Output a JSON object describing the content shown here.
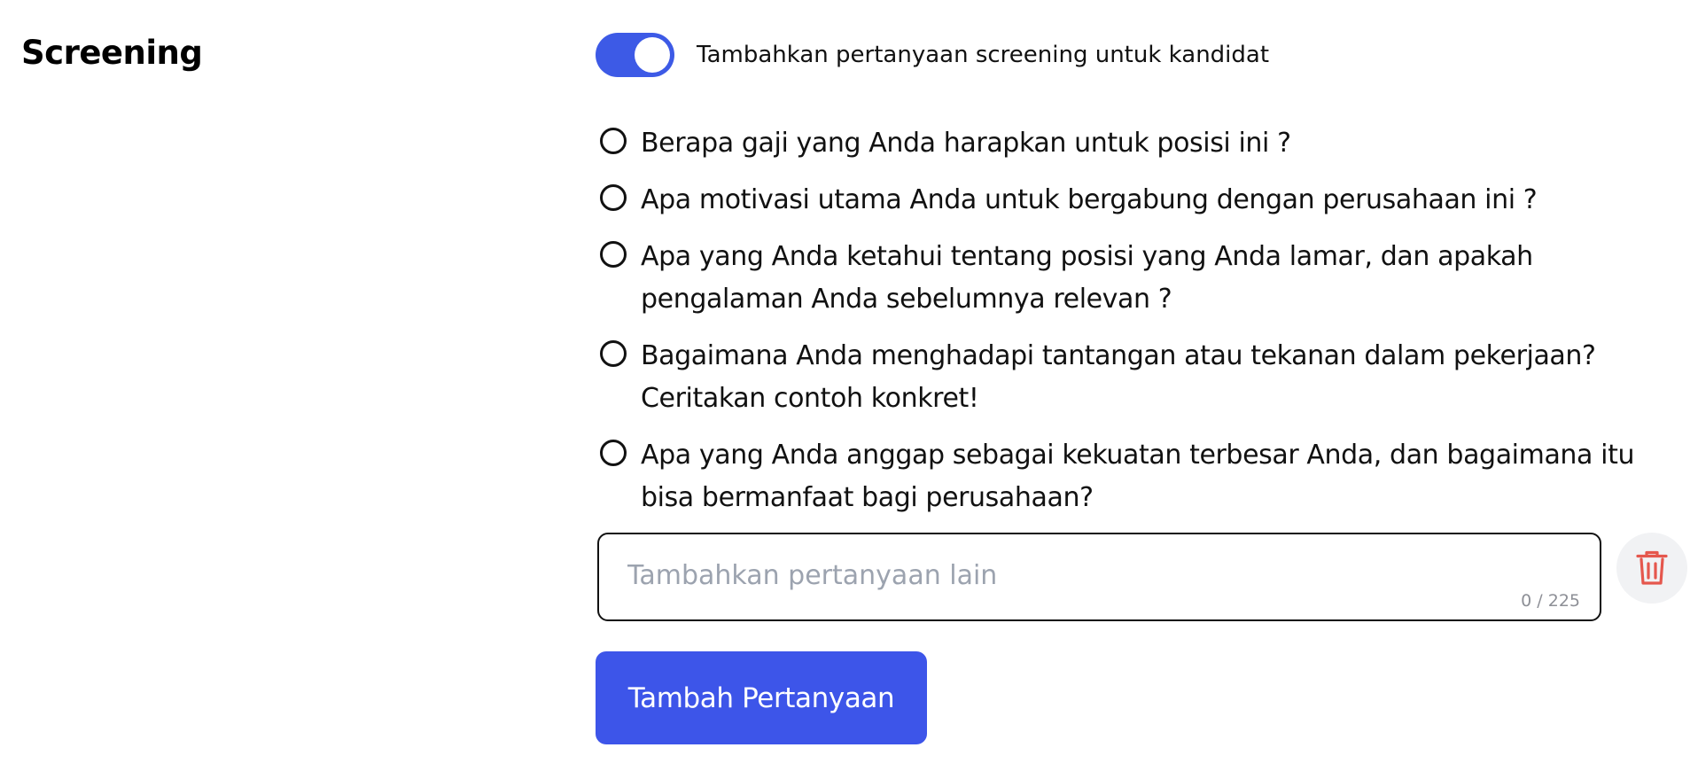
{
  "section": {
    "title": "Screening"
  },
  "toggle": {
    "label": "Tambahkan pertanyaan screening untuk kandidat",
    "state": "on",
    "color": "#3d5ae6"
  },
  "questions": [
    {
      "text": "Berapa gaji yang Anda harapkan untuk posisi ini ?"
    },
    {
      "text": "Apa motivasi utama Anda untuk bergabung dengan perusahaan ini ?"
    },
    {
      "text": "Apa yang Anda ketahui tentang posisi yang Anda lamar, dan apakah pengalaman Anda sebelumnya relevan ?"
    },
    {
      "text": "Bagaimana Anda menghadapi tantangan atau tekanan dalam pekerjaan? Ceritakan contoh konkret!"
    },
    {
      "text": "Apa yang Anda anggap sebagai kekuatan terbesar Anda, dan bagaimana itu bisa bermanfaat bagi perusahaan?"
    }
  ],
  "other_question": {
    "placeholder": "Tambahkan pertanyaan lain",
    "value": "",
    "counter": "0 / 225",
    "delete_icon": "trash-icon",
    "delete_icon_color": "#e5574d"
  },
  "add_button": {
    "label": "Tambah Pertanyaan",
    "color": "#3d55e9"
  }
}
